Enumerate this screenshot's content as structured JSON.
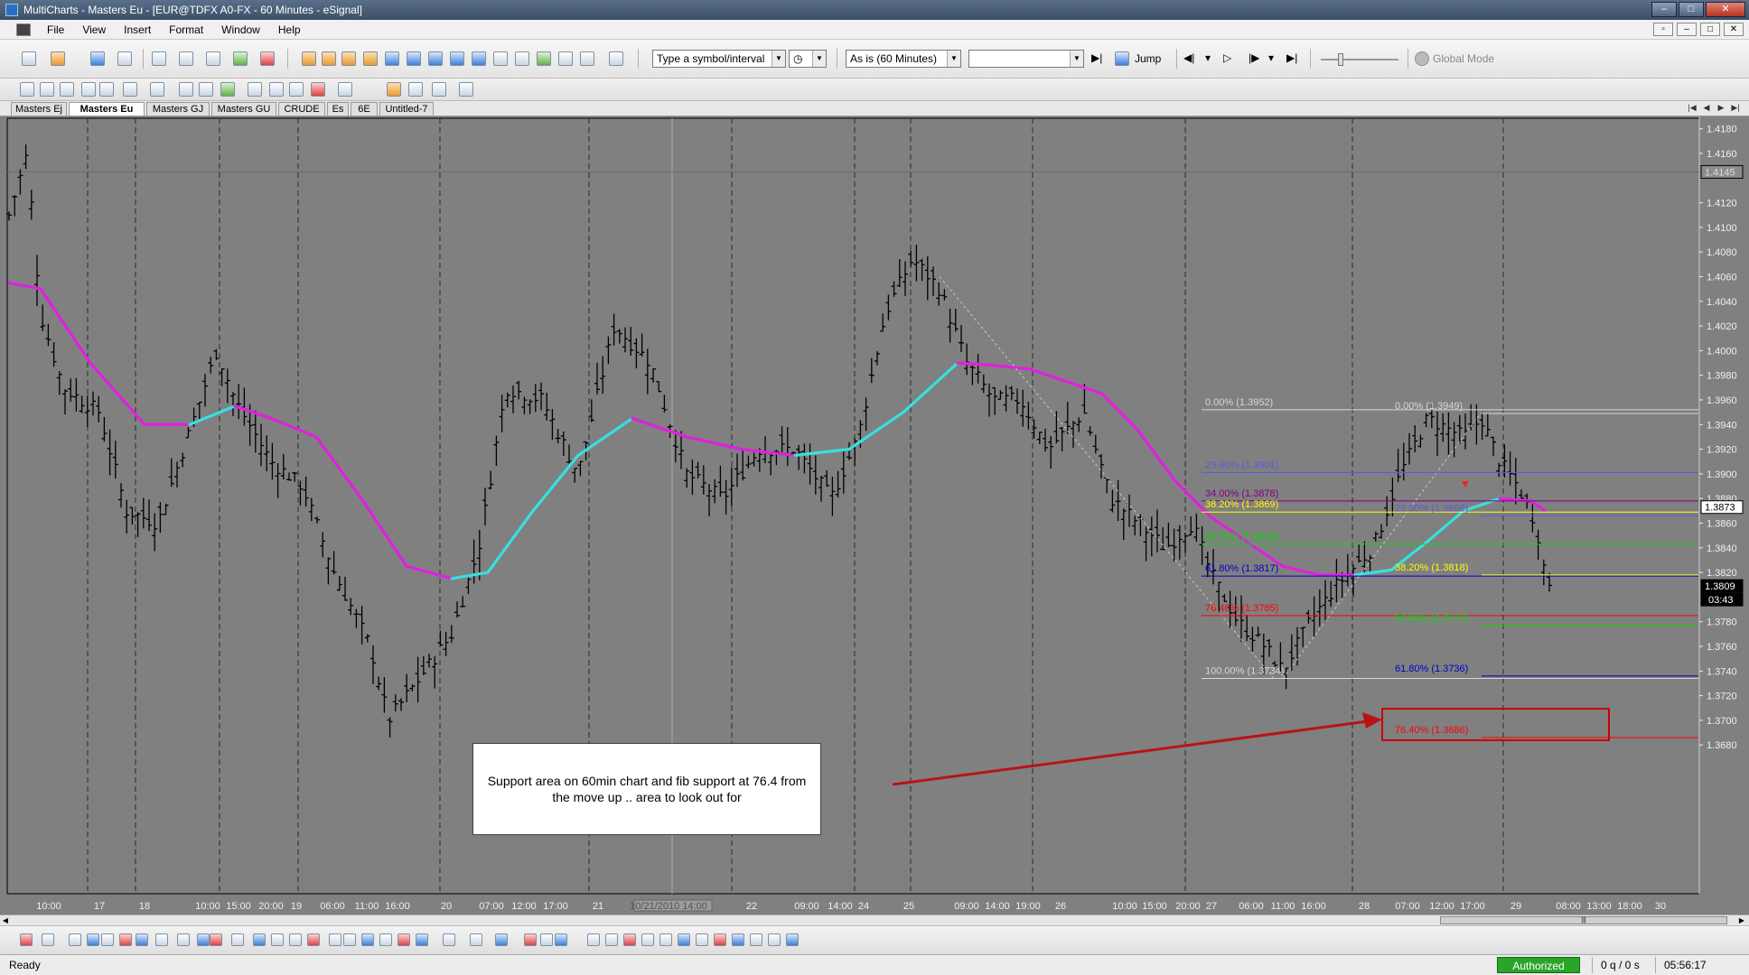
{
  "window": {
    "title": "MultiCharts - Masters Eu - [EUR@TDFX A0-FX - 60 Minutes - eSignal]"
  },
  "menu": {
    "items": [
      "File",
      "View",
      "Insert",
      "Format",
      "Window",
      "Help"
    ]
  },
  "toolbar": {
    "symbol_combo": "Type a symbol/interval",
    "resolution_combo": "As is (60 Minutes)",
    "jump_label": "Jump",
    "global_mode_label": "Global Mode"
  },
  "workspace_tabs": [
    "Masters Ej",
    "Masters Eu",
    "Masters GJ",
    "Masters GU",
    "CRUDE",
    "Es",
    "6E",
    "Untitled-7"
  ],
  "active_tab": "Masters Eu",
  "chart": {
    "symbol": "EUR@TDFX A0-FX",
    "interval": "60 Minutes",
    "y_axis_labels": [
      "1.4180",
      "1.4160",
      "1.4120",
      "1.4100",
      "1.4080",
      "1.4060",
      "1.4040",
      "1.4020",
      "1.4000",
      "1.3980",
      "1.3960",
      "1.3940",
      "1.3920",
      "1.3900",
      "1.3880",
      "1.3860",
      "1.3840",
      "1.3820",
      "1.3780",
      "1.3760",
      "1.3740",
      "1.3720",
      "1.3700",
      "1.3680"
    ],
    "price_tags": {
      "high_marker": "1.4145",
      "ma_value": "1.3873",
      "last_price": "1.3809",
      "bar_countdown": "03:43"
    },
    "x_axis_labels": [
      "10:00",
      "17",
      "18",
      "10:00",
      "15:00",
      "20:00",
      "19",
      "06:00",
      "11:00",
      "16:00",
      "20",
      "07:00",
      "12:00",
      "17:00",
      "21",
      "10/21/2010 14:00",
      "22",
      "09:00",
      "14:00",
      "24",
      "25",
      "09:00",
      "14:00",
      "19:00",
      "26",
      "10:00",
      "15:00",
      "20:00",
      "27",
      "06:00",
      "11:00",
      "16:00",
      "28",
      "07:00",
      "12:00",
      "17:00",
      "29",
      "08:00",
      "13:00",
      "18:00",
      "30"
    ],
    "fib_left": [
      {
        "label": "0.00% (1.3952)",
        "color": "#d8d8d8"
      },
      {
        "label": "23.60% (1.3901)",
        "color": "#5a5ae0"
      },
      {
        "label": "34.00% (1.3878)",
        "color": "#800080"
      },
      {
        "label": "38.20% (1.3869)",
        "color": "#ffff00"
      },
      {
        "label": "50.00% (1.3843)",
        "color": "#00e000"
      },
      {
        "label": "61.80% (1.3817)",
        "color": "#0000c8"
      },
      {
        "label": "76.40% (1.3785)",
        "color": "#ff0000"
      },
      {
        "label": "100.00% (1.3734)",
        "color": "#d8d8d8"
      }
    ],
    "fib_right": [
      {
        "label": "0.00% (1.3949)",
        "color": "#d8d8d8"
      },
      {
        "label": "23.60% (1.3866)",
        "color": "#5a5ae0"
      },
      {
        "label": "38.20% (1.3818)",
        "color": "#ffff00"
      },
      {
        "label": "50.00% (1.3777)",
        "color": "#00e000"
      },
      {
        "label": "61.80% (1.3736)",
        "color": "#0000c8"
      },
      {
        "label": "76.40% (1.3686)",
        "color": "#ff0000"
      }
    ],
    "annotation": "Support area on 60min chart and fib support at 76.4 from the move up .. area to look out for"
  },
  "status": {
    "ready": "Ready",
    "authorized": "Authorized",
    "quotes": "0 q / 0 s",
    "clock": "05:56:17"
  }
}
